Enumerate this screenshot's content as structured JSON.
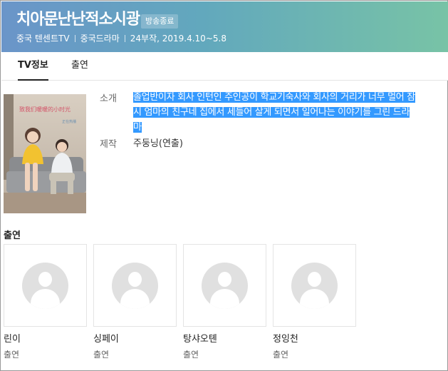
{
  "header": {
    "title": "치아문난난적소시광",
    "badge": "방송종료",
    "meta": [
      "중국 텐센트TV",
      "중국드라마",
      "24부작, 2019.4.10~5.8"
    ]
  },
  "tabs": [
    {
      "label": "TV정보",
      "active": true
    },
    {
      "label": "출연",
      "active": false
    }
  ],
  "poster": {
    "title_text": "致我们暖暖的小时光",
    "sub_text": "正在热播"
  },
  "info": {
    "intro_label": "소개",
    "intro_lines": [
      "졸업반이자 회사 인턴인 주인공이 학교기숙사와 회사의 거리가 너무 멀어 잠",
      "시 엄마의 친구네 집에서 세들어 살게 되면서 일어나는 이야기를 그린 드라",
      "마"
    ],
    "producer_label": "제작",
    "producer_value": "주둥닝(연출)"
  },
  "cast": {
    "heading": "출연",
    "members": [
      {
        "name": "린이",
        "role": "출연"
      },
      {
        "name": "싱페이",
        "role": "출연"
      },
      {
        "name": "탕샤오톈",
        "role": "출연"
      },
      {
        "name": "정잉천",
        "role": "출연"
      }
    ]
  },
  "colors": {
    "header_gradient": [
      "#6a95c9",
      "#62a8bd",
      "#78c3a6"
    ],
    "selection": "#3399ff"
  }
}
